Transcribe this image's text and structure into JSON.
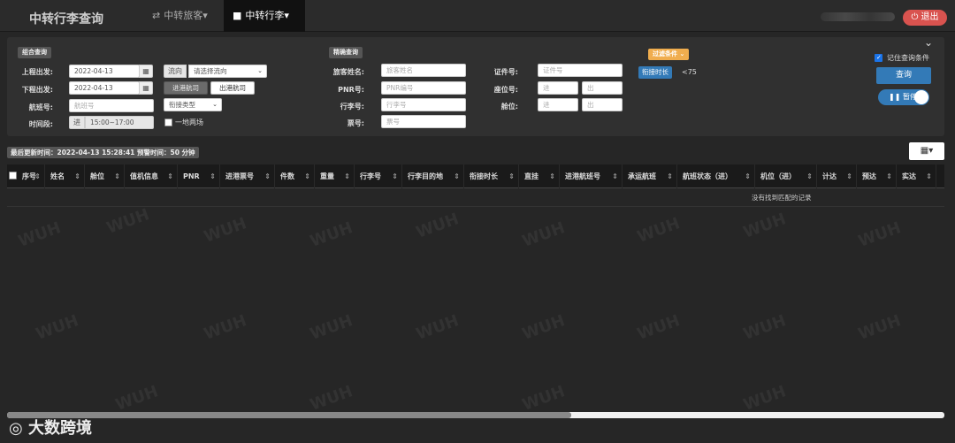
{
  "app": {
    "title": "中转行李查询",
    "nav": [
      {
        "label": "中转旅客▾",
        "icon": "shuffle-icon"
      },
      {
        "label": "中转行李▾",
        "icon": "briefcase-icon"
      }
    ],
    "logout_label": "退出"
  },
  "combo": {
    "section_label": "组合查询",
    "upper_departure_label": "上程出发:",
    "upper_departure_value": "2022-04-13",
    "flow_addon": "流向",
    "flow_select": "请选择流向",
    "lower_departure_label": "下程出发:",
    "lower_departure_value": "2022-04-13",
    "inbound_btn": "进港航司",
    "outbound_btn": "出港航司",
    "flight_label": "航班号:",
    "flight_placeholder": "航班号",
    "connection_type": "衔接类型",
    "time_label": "时间段:",
    "time_addon": "进",
    "time_value": "15:00~17:00",
    "same_place_label": "一地两场"
  },
  "exact": {
    "section_label": "精确查询",
    "name_label": "旅客姓名:",
    "name_placeholder": "旅客姓名",
    "pnr_label": "PNR号:",
    "pnr_placeholder": "PNR编号",
    "bag_label": "行李号:",
    "bag_placeholder": "行李号",
    "ticket_label": "票号:",
    "ticket_placeholder": "票号",
    "id_label": "证件号:",
    "id_placeholder": "证件号",
    "seat_label": "座位号:",
    "seat_in": "进",
    "seat_out": "出",
    "cabin_label": "舱位:",
    "cabin_in": "进",
    "cabin_out": "出"
  },
  "filter": {
    "label": "过滤条件",
    "connect_btn": "衔接时长",
    "connect_value": "<75"
  },
  "right": {
    "remember_label": "记住查询条件",
    "query_btn": "查询",
    "pause_btn": "暂停"
  },
  "status": {
    "text": "最后更新时间：2022-04-13 15:28:41 预警时间：50 分钟"
  },
  "table": {
    "headers": [
      "序号",
      "姓名",
      "舱位",
      "值机信息",
      "PNR",
      "进港票号",
      "件数",
      "重量",
      "行李号",
      "行李目的地",
      "衔接时长",
      "直挂",
      "进港航班号",
      "承运航班",
      "航班状态（进）",
      "机位（进）",
      "计达",
      "预达",
      "实达"
    ],
    "empty_text": "没有找到匹配的记录"
  },
  "footer": {
    "logo_text": "大数跨境"
  },
  "watermark": "WUH"
}
